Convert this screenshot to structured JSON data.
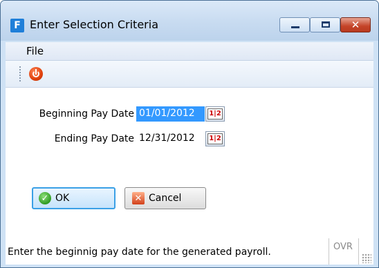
{
  "window": {
    "title": "Enter Selection Criteria",
    "icon": "app-logo-icon",
    "controls": {
      "minimize": "minimize-icon",
      "maximize": "maximize-icon",
      "close_glyph": "✕"
    }
  },
  "menu": {
    "file_label": "File"
  },
  "toolbar": {
    "power_icon": "power-icon"
  },
  "form": {
    "beginning_label": "Beginning Pay Date",
    "beginning_value": "01/01/2012",
    "ending_label": "Ending Pay Date",
    "ending_value": "12/31/2012",
    "calendar_glyph": "1|2"
  },
  "buttons": {
    "ok_label": "OK",
    "cancel_label": "Cancel"
  },
  "status": {
    "message": "Enter the beginnig pay date for the generated payroll.",
    "mode": "OVR"
  },
  "colors": {
    "selection": "#3399ff",
    "accent": "#3aa0e6",
    "close": "#c44328"
  }
}
